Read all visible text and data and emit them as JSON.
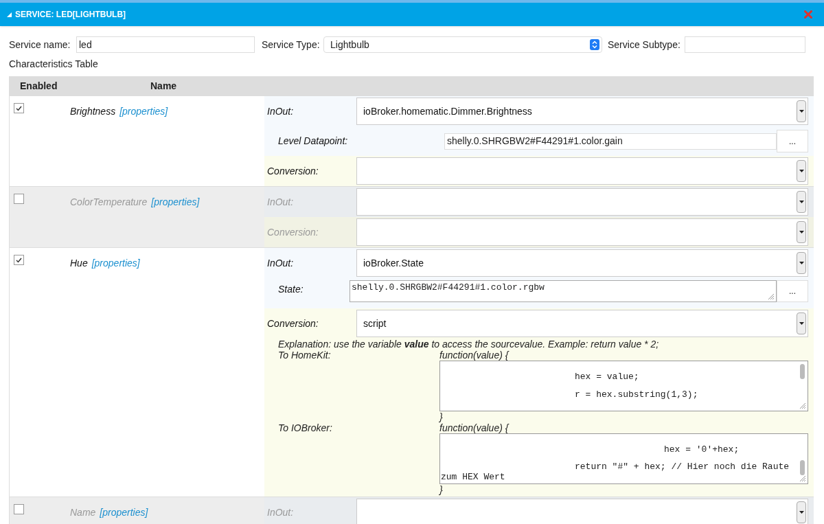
{
  "header": {
    "title": "SERVICE: LED[LIGHTBULB]"
  },
  "form": {
    "service_name": {
      "label": "Service name:",
      "value": "led"
    },
    "service_type": {
      "label": "Service Type:",
      "value": "Lightbulb"
    },
    "service_subtype": {
      "label": "Service Subtype:"
    }
  },
  "characteristics_title": "Characteristics Table",
  "columns": [
    "Enabled",
    "Name"
  ],
  "rows": [
    {
      "enabled": true,
      "name": "Brightness",
      "link": "[properties]",
      "fields": [
        {
          "kind": "select",
          "label": "InOut:",
          "value": "ioBroker.homematic.Dimmer.Brightness"
        },
        {
          "kind": "datapoint",
          "label": "Level Datapoint:",
          "value": "shelly.0.SHRGBW2#F44291#1.color.gain",
          "button": "..."
        },
        {
          "kind": "select",
          "label": "Conversion:"
        }
      ]
    },
    {
      "enabled": false,
      "name": "ColorTemperature",
      "link": "[properties]",
      "fields": [
        {
          "kind": "select",
          "label": "InOut:"
        },
        {
          "kind": "select",
          "label": "Conversion:"
        }
      ]
    },
    {
      "enabled": true,
      "name": "Hue",
      "link": "[properties]",
      "fields": [
        {
          "kind": "select",
          "label": "InOut:",
          "value": "ioBroker.State"
        },
        {
          "kind": "state",
          "label": "State:",
          "value": "shelly.0.SHRGBW2#F44291#1.color.rgbw",
          "button": "..."
        },
        {
          "kind": "select",
          "label": "Conversion:",
          "value": "script"
        },
        {
          "kind": "script",
          "explanation": "Explanation: use the variable **value** to access the sourcevalue. Example: return value * 2;",
          "blocks": [
            {
              "label": "To HomeKit:",
              "open": "function(value) {",
              "lines": [
                "hex = value;",
                "r = hex.substring(1,3);"
              ],
              "close": "}"
            },
            {
              "label": "To IOBroker:",
              "open": "function(value) {",
              "lines": [
                "hex = '0'+hex;",
                "return \"#\" + hex; // Hier noch die Raute zum HEX Wert"
              ],
              "close": "}"
            }
          ]
        }
      ]
    },
    {
      "enabled": false,
      "name": "Name",
      "link": "[properties]",
      "fields": [
        {
          "kind": "select",
          "label": "InOut:"
        }
      ]
    }
  ]
}
